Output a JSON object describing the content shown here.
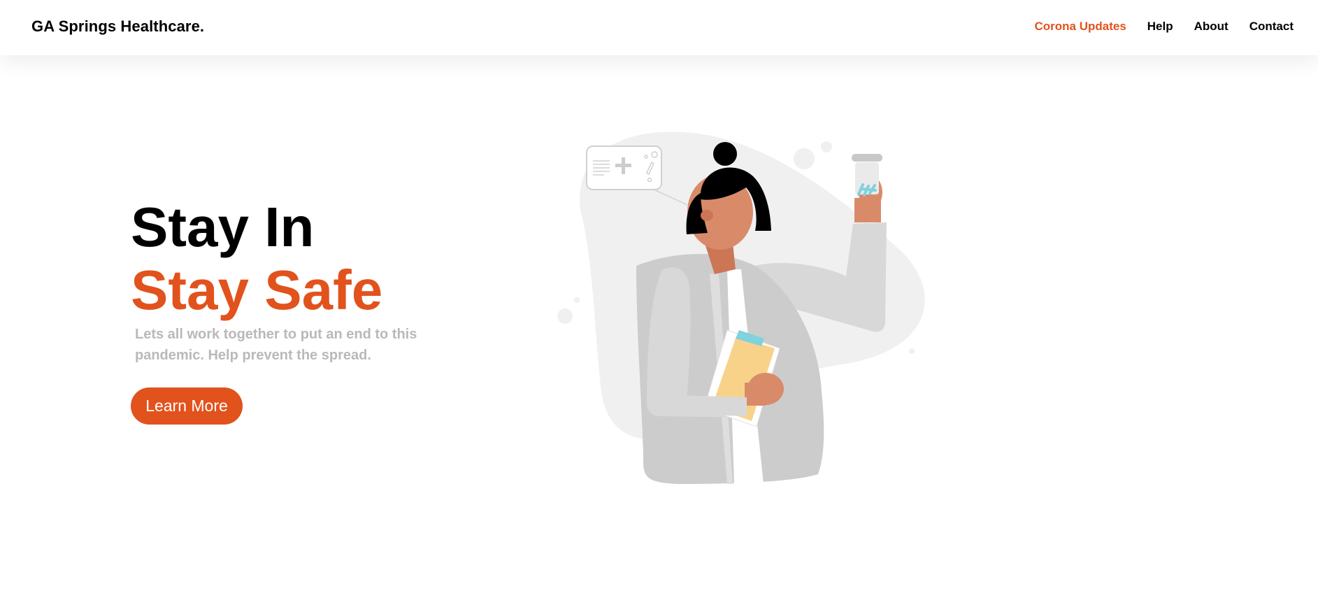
{
  "header": {
    "brand": "GA Springs Healthcare.",
    "nav": [
      {
        "label": "Corona Updates",
        "active": true
      },
      {
        "label": "Help",
        "active": false
      },
      {
        "label": "About",
        "active": false
      },
      {
        "label": "Contact",
        "active": false
      }
    ]
  },
  "hero": {
    "title_line1": "Stay In",
    "title_line2": "Stay Safe",
    "subtitle": "Lets all work together to put an end to this pandemic. Help prevent the spread.",
    "cta_label": "Learn More"
  },
  "colors": {
    "accent": "#e2521d",
    "text": "#000000",
    "muted": "#b9b9b9",
    "illustration_gray": "#cccccc",
    "skin": "#d98b69",
    "folder": "#f9d28a",
    "pills": "#7fd2de"
  },
  "illustration": {
    "subject": "doctor-holding-pill-jar-and-clipboard"
  }
}
